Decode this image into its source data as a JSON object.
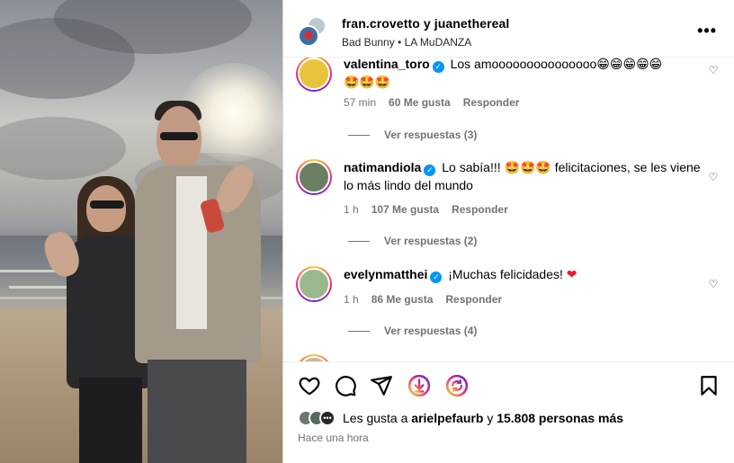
{
  "header": {
    "users": "fran.crovetto y juanethereal",
    "audio": "Bad Bunny • LA MuDANZA",
    "more_icon": "more-horizontal-icon"
  },
  "comments": [
    {
      "user": "valentina_toro",
      "text": "Los amooooooooooooooo",
      "emojis": "😁😁😁😁😁",
      "emojis2": "🤩🤩🤩",
      "time": "57 min",
      "likes": "60 Me gusta",
      "reply": "Responder",
      "view_replies": "Ver respuestas (3)",
      "avatar_color": "#e8c43a"
    },
    {
      "user": "natimandiola",
      "text": "Lo sabía!!!",
      "emojis": "🤩🤩🤩",
      "text2": "felicitaciones, se les viene lo más lindo del mundo",
      "time": "1 h",
      "likes": "107 Me gusta",
      "reply": "Responder",
      "view_replies": "Ver respuestas (2)",
      "avatar_color": "#6b7f63"
    },
    {
      "user": "evelynmatthei",
      "text": "¡Muchas felicidades!",
      "emojis": "❤",
      "time": "1 h",
      "likes": "86 Me gusta",
      "reply": "Responder",
      "view_replies": "Ver respuestas (4)",
      "avatar_color": "#9bb88c"
    }
  ],
  "actions": {
    "like_icon": "heart-icon",
    "comment_icon": "comment-icon",
    "share_icon": "send-icon",
    "download_icon": "download-icon",
    "repost_icon": "repost-icon",
    "save_icon": "bookmark-icon"
  },
  "likes": {
    "prefix": "Les gusta a",
    "user": "arielpefaurb",
    "middle": "y",
    "count": "15.808 personas más"
  },
  "timestamp": "Hace una hora",
  "colors": {
    "verified": "#0095f6",
    "secondary_text": "#737373",
    "heart_red": "#ed1c24"
  }
}
